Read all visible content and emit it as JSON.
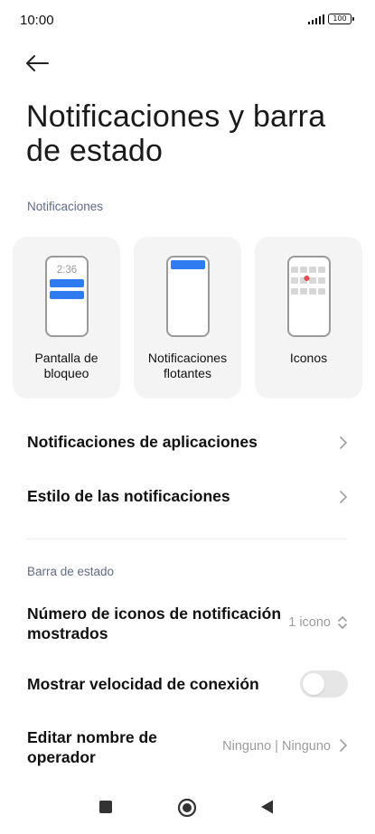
{
  "status_bar": {
    "time": "10:00",
    "battery": "100",
    "icons": [
      "signal-icon",
      "battery-icon"
    ]
  },
  "header": {
    "back_icon": "arrow-left-icon",
    "title": "Notificaciones y barra de estado"
  },
  "notifications_section": {
    "header": "Notificaciones",
    "cards": [
      {
        "label": "Pantalla de bloqueo",
        "icon": "lock-screen-phone-icon",
        "clock": "2:36"
      },
      {
        "label": "Notificaciones flotantes",
        "icon": "floating-notification-phone-icon"
      },
      {
        "label": "Iconos",
        "icon": "app-icons-phone-icon"
      }
    ],
    "rows": [
      {
        "label": "Notificaciones de aplicaciones",
        "icon": "chevron-right-icon"
      },
      {
        "label": "Estilo de las notificaciones",
        "icon": "chevron-right-icon"
      }
    ]
  },
  "status_bar_section": {
    "header": "Barra de estado",
    "notification_icons": {
      "label": "Número de iconos de notificación mostrados",
      "value": "1 icono",
      "icon": "chevron-up-down-icon"
    },
    "connection_speed": {
      "label": "Mostrar velocidad de conexión",
      "enabled": false
    },
    "operator_name": {
      "label": "Editar nombre de operador",
      "value": "Ninguno | Ninguno",
      "icon": "chevron-right-icon"
    }
  },
  "nav_bar": {
    "icons": [
      "recents-square-icon",
      "home-circle-icon",
      "back-triangle-icon"
    ]
  },
  "colors": {
    "section_header": "#5f6b87",
    "card_background": "#f4f4f4",
    "accent_blue": "#2f7bf0",
    "notification_dot": "#e94b4b",
    "toggle_off": "#e6e6e6"
  }
}
